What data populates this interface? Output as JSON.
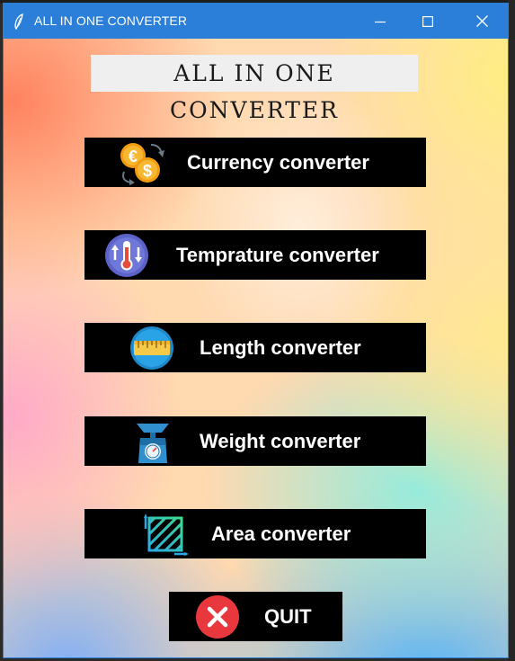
{
  "window": {
    "title": "ALL IN ONE CONVERTER",
    "title_icon": "feather-icon",
    "controls": [
      "minimize-icon",
      "maximize-icon",
      "close-icon"
    ],
    "titlebar_color": "#2c7fd8"
  },
  "header": {
    "title": "ALL IN ONE CONVERTER"
  },
  "buttons": [
    {
      "label": "Currency converter",
      "icon": "currency-exchange-icon"
    },
    {
      "label": "Temprature converter",
      "icon": "thermometer-icon"
    },
    {
      "label": "Length converter",
      "icon": "ruler-icon"
    },
    {
      "label": "Weight converter",
      "icon": "weighing-scale-icon"
    },
    {
      "label": "Area converter",
      "icon": "area-icon"
    }
  ],
  "quit": {
    "label": "QUIT",
    "icon": "close-circle-icon",
    "icon_color": "#e8383d"
  },
  "colors": {
    "button_bg": "#000000",
    "button_text": "#ffffff"
  }
}
